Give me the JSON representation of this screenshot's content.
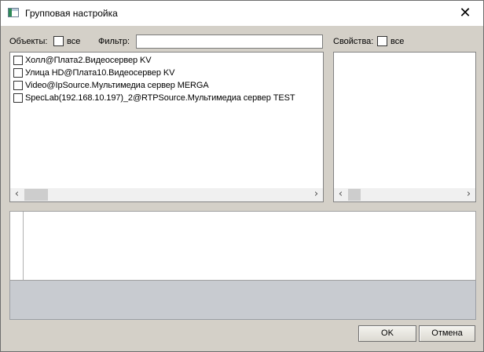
{
  "window": {
    "title": "Групповая настройка",
    "close_glyph": "✕"
  },
  "objects": {
    "label": "Объекты:",
    "all_label": "все",
    "all_checked": false,
    "filter_label": "Фильтр:",
    "filter_value": "",
    "items": [
      {
        "label": "Холл@Плата2.Видеосервер KV",
        "checked": false
      },
      {
        "label": "Улица HD@Плата10.Видеосервер KV",
        "checked": false
      },
      {
        "label": "Video@IpSource.Мультимедиа сервер MERGA",
        "checked": false
      },
      {
        "label": "SpecLab(192.168.10.197)_2@RTPSource.Мультимедиа сервер TEST",
        "checked": false
      }
    ]
  },
  "properties": {
    "label": "Свойства:",
    "all_label": "все",
    "all_checked": false
  },
  "scroll": {
    "left_glyph": "‹",
    "right_glyph": "›"
  },
  "buttons": {
    "ok": "OK",
    "cancel": "Отмена"
  },
  "icons": {
    "app": "window-app-icon",
    "close": "close-icon"
  }
}
